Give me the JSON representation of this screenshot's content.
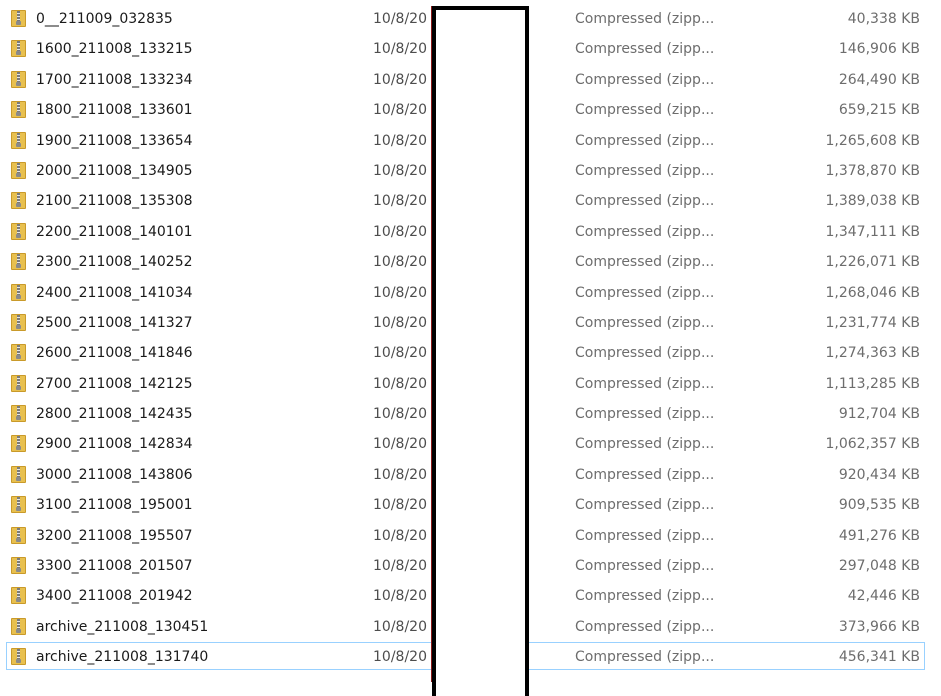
{
  "files": [
    {
      "name": "0__211009_032835",
      "date": "10/8/20",
      "type": "Compressed (zipp...",
      "size": "40,338 KB"
    },
    {
      "name": "1600_211008_133215",
      "date": "10/8/20",
      "type": "Compressed (zipp...",
      "size": "146,906 KB"
    },
    {
      "name": "1700_211008_133234",
      "date": "10/8/20",
      "type": "Compressed (zipp...",
      "size": "264,490 KB"
    },
    {
      "name": "1800_211008_133601",
      "date": "10/8/20",
      "type": "Compressed (zipp...",
      "size": "659,215 KB"
    },
    {
      "name": "1900_211008_133654",
      "date": "10/8/20",
      "type": "Compressed (zipp...",
      "size": "1,265,608 KB"
    },
    {
      "name": "2000_211008_134905",
      "date": "10/8/20",
      "type": "Compressed (zipp...",
      "size": "1,378,870 KB"
    },
    {
      "name": "2100_211008_135308",
      "date": "10/8/20",
      "type": "Compressed (zipp...",
      "size": "1,389,038 KB"
    },
    {
      "name": "2200_211008_140101",
      "date": "10/8/20",
      "type": "Compressed (zipp...",
      "size": "1,347,111 KB"
    },
    {
      "name": "2300_211008_140252",
      "date": "10/8/20",
      "type": "Compressed (zipp...",
      "size": "1,226,071 KB"
    },
    {
      "name": "2400_211008_141034",
      "date": "10/8/20",
      "type": "Compressed (zipp...",
      "size": "1,268,046 KB"
    },
    {
      "name": "2500_211008_141327",
      "date": "10/8/20",
      "type": "Compressed (zipp...",
      "size": "1,231,774 KB"
    },
    {
      "name": "2600_211008_141846",
      "date": "10/8/20",
      "type": "Compressed (zipp...",
      "size": "1,274,363 KB"
    },
    {
      "name": "2700_211008_142125",
      "date": "10/8/20",
      "type": "Compressed (zipp...",
      "size": "1,113,285 KB"
    },
    {
      "name": "2800_211008_142435",
      "date": "10/8/20",
      "type": "Compressed (zipp...",
      "size": "912,704 KB"
    },
    {
      "name": "2900_211008_142834",
      "date": "10/8/20",
      "type": "Compressed (zipp...",
      "size": "1,062,357 KB"
    },
    {
      "name": "3000_211008_143806",
      "date": "10/8/20",
      "type": "Compressed (zipp...",
      "size": "920,434 KB"
    },
    {
      "name": "3100_211008_195001",
      "date": "10/8/20",
      "type": "Compressed (zipp...",
      "size": "909,535 KB"
    },
    {
      "name": "3200_211008_195507",
      "date": "10/8/20",
      "type": "Compressed (zipp...",
      "size": "491,276 KB"
    },
    {
      "name": "3300_211008_201507",
      "date": "10/8/20",
      "type": "Compressed (zipp...",
      "size": "297,048 KB"
    },
    {
      "name": "3400_211008_201942",
      "date": "10/8/20",
      "type": "Compressed (zipp...",
      "size": "42,446 KB"
    },
    {
      "name": "archive_211008_130451",
      "date": "10/8/20",
      "type": "Compressed (zipp...",
      "size": "373,966 KB"
    },
    {
      "name": "archive_211008_131740",
      "date": "10/8/20",
      "type": "Compressed (zipp...",
      "size": "456,341 KB",
      "selected": true
    }
  ],
  "icon": "zip-folder-icon",
  "colors": {
    "selection_border": "#99d1ff",
    "redaction": "#000000"
  }
}
